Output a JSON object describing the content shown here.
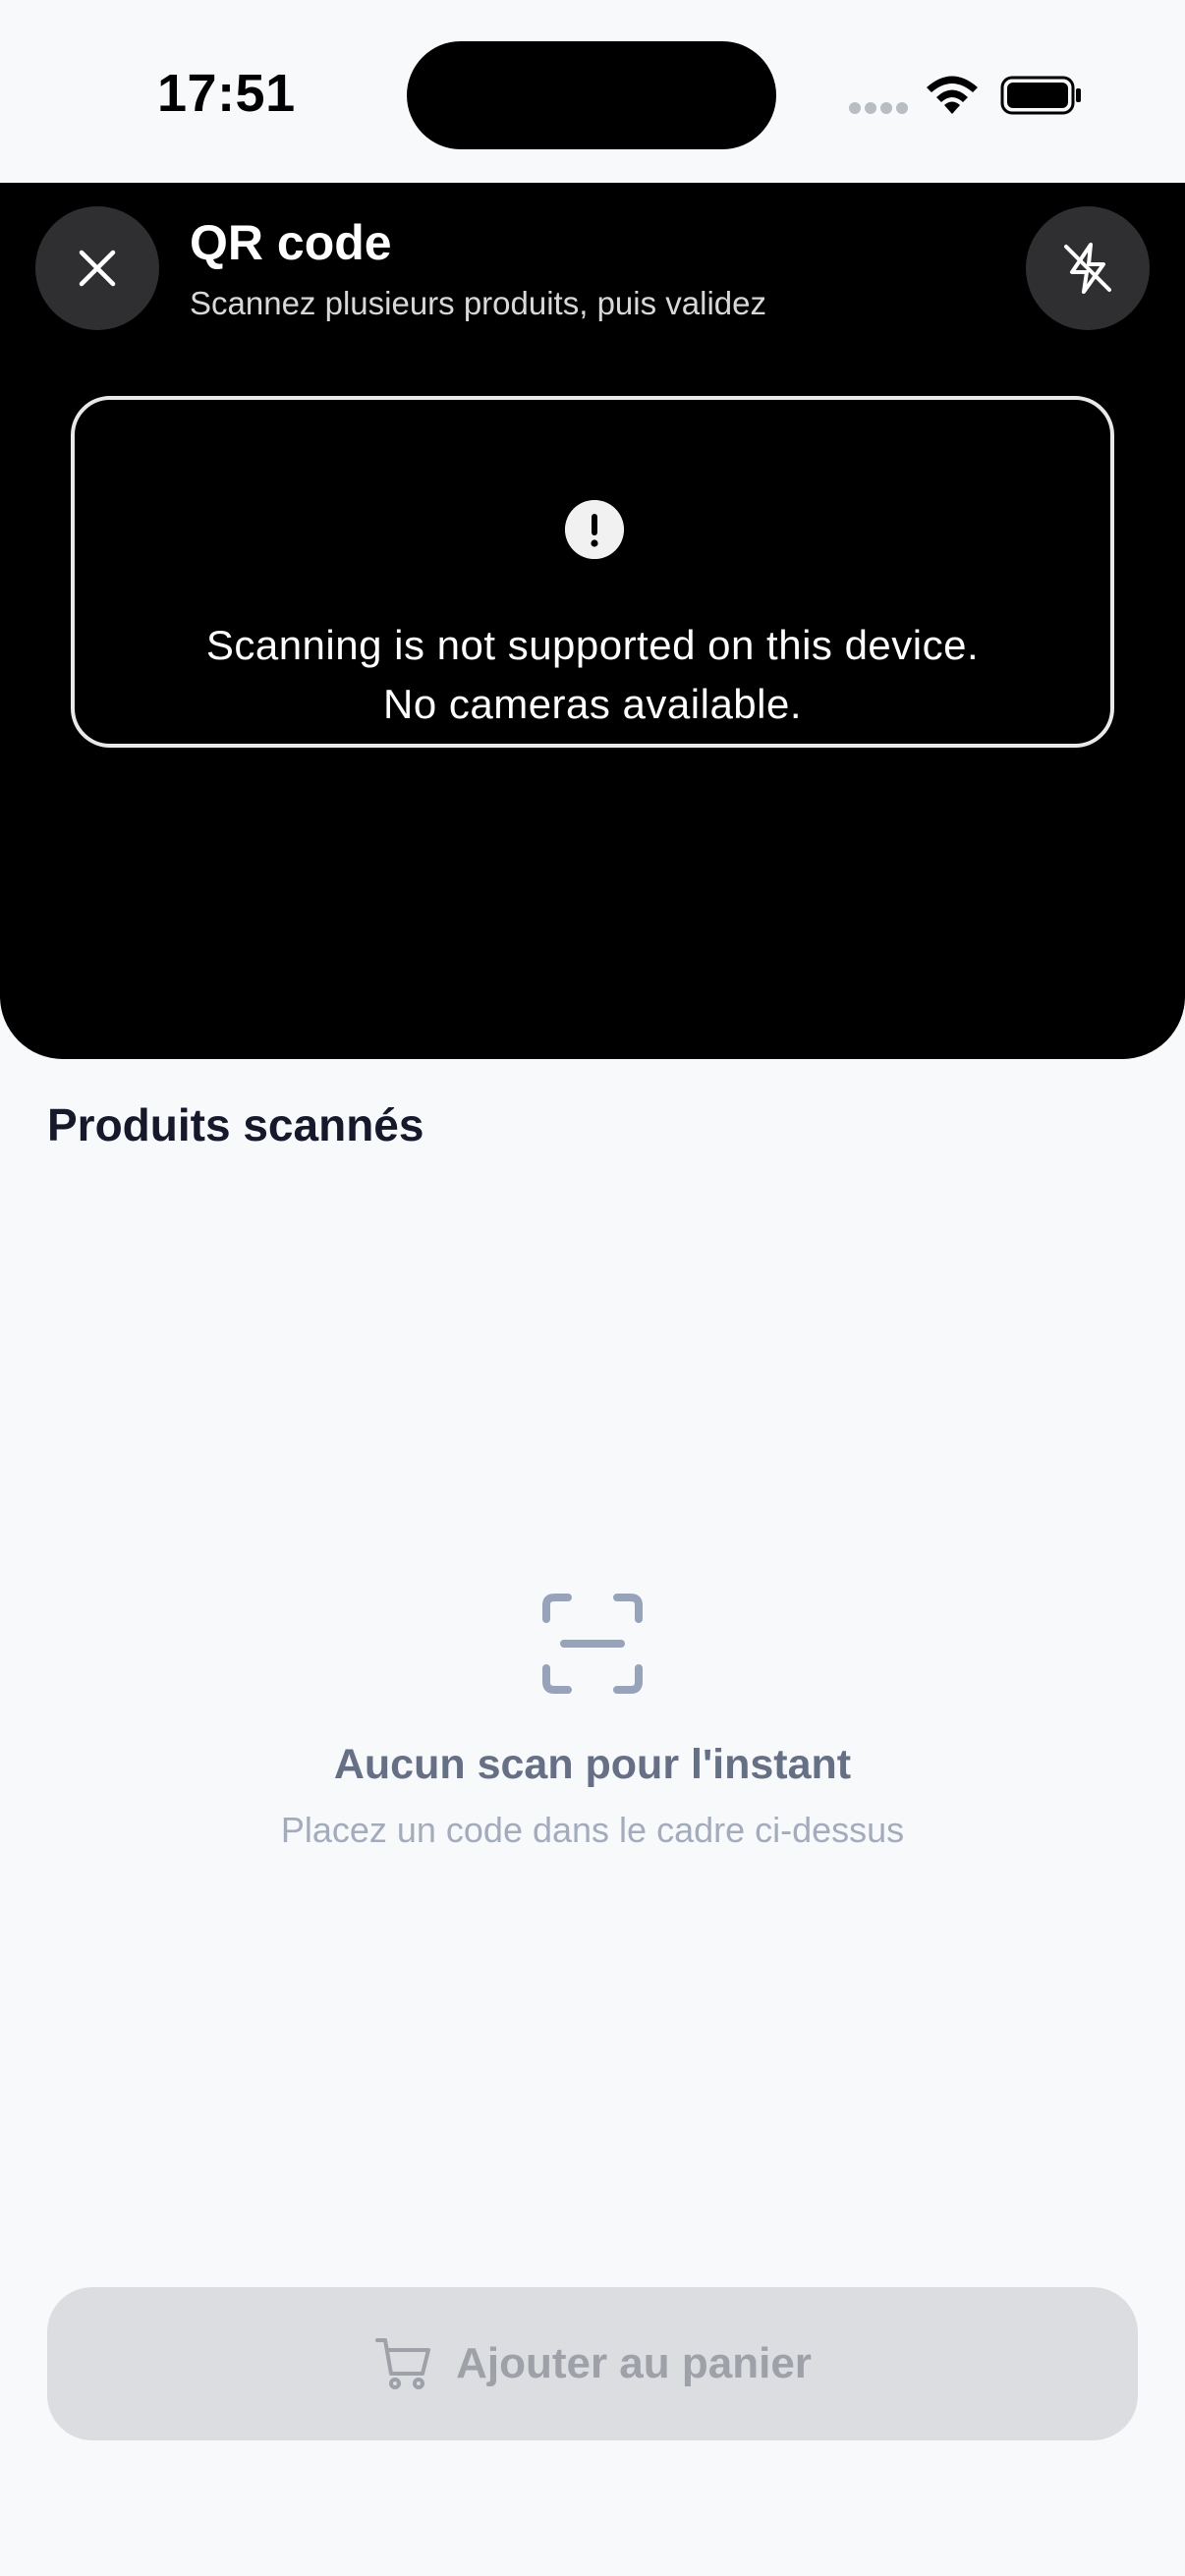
{
  "status_bar": {
    "time": "17:51",
    "icons": [
      "signal-icon",
      "wifi-icon",
      "battery-icon"
    ]
  },
  "scanner": {
    "title": "QR code",
    "subtitle": "Scannez plusieurs produits, puis validez",
    "close_icon": "close-icon",
    "flash_icon": "flash-off-icon",
    "error": {
      "icon": "exclamation-icon",
      "line1": "Scanning is not supported on this device.",
      "line2": "No cameras available."
    }
  },
  "products": {
    "section_title": "Produits scannés",
    "empty_state": {
      "icon": "scan-frame-icon",
      "title": "Aucun scan pour l'instant",
      "subtitle": "Placez un code dans le cadre ci-dessus"
    }
  },
  "actions": {
    "add_to_cart_label": "Ajouter au panier",
    "add_to_cart_icon": "cart-icon",
    "add_to_cart_disabled": true
  },
  "colors": {
    "scanner_bg": "#000000",
    "page_bg": "#f8f9fb",
    "heading": "#15192b",
    "muted": "#657086",
    "disabled_button": "#dcdde0"
  }
}
